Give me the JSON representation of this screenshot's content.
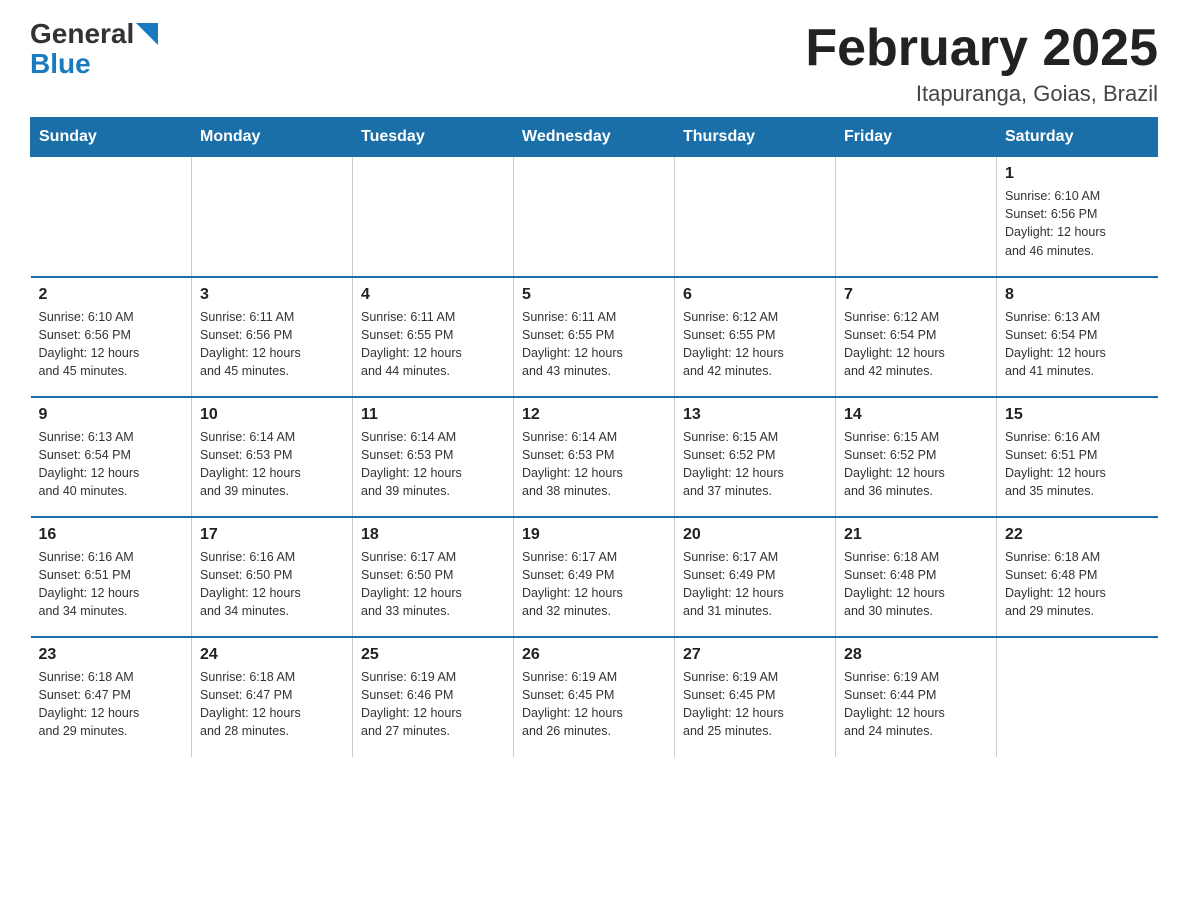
{
  "logo": {
    "general": "General",
    "blue": "Blue",
    "arrow": "▲"
  },
  "title": "February 2025",
  "subtitle": "Itapuranga, Goias, Brazil",
  "days_of_week": [
    "Sunday",
    "Monday",
    "Tuesday",
    "Wednesday",
    "Thursday",
    "Friday",
    "Saturday"
  ],
  "weeks": [
    {
      "days": [
        {
          "num": "",
          "info": ""
        },
        {
          "num": "",
          "info": ""
        },
        {
          "num": "",
          "info": ""
        },
        {
          "num": "",
          "info": ""
        },
        {
          "num": "",
          "info": ""
        },
        {
          "num": "",
          "info": ""
        },
        {
          "num": "1",
          "info": "Sunrise: 6:10 AM\nSunset: 6:56 PM\nDaylight: 12 hours\nand 46 minutes."
        }
      ]
    },
    {
      "days": [
        {
          "num": "2",
          "info": "Sunrise: 6:10 AM\nSunset: 6:56 PM\nDaylight: 12 hours\nand 45 minutes."
        },
        {
          "num": "3",
          "info": "Sunrise: 6:11 AM\nSunset: 6:56 PM\nDaylight: 12 hours\nand 45 minutes."
        },
        {
          "num": "4",
          "info": "Sunrise: 6:11 AM\nSunset: 6:55 PM\nDaylight: 12 hours\nand 44 minutes."
        },
        {
          "num": "5",
          "info": "Sunrise: 6:11 AM\nSunset: 6:55 PM\nDaylight: 12 hours\nand 43 minutes."
        },
        {
          "num": "6",
          "info": "Sunrise: 6:12 AM\nSunset: 6:55 PM\nDaylight: 12 hours\nand 42 minutes."
        },
        {
          "num": "7",
          "info": "Sunrise: 6:12 AM\nSunset: 6:54 PM\nDaylight: 12 hours\nand 42 minutes."
        },
        {
          "num": "8",
          "info": "Sunrise: 6:13 AM\nSunset: 6:54 PM\nDaylight: 12 hours\nand 41 minutes."
        }
      ]
    },
    {
      "days": [
        {
          "num": "9",
          "info": "Sunrise: 6:13 AM\nSunset: 6:54 PM\nDaylight: 12 hours\nand 40 minutes."
        },
        {
          "num": "10",
          "info": "Sunrise: 6:14 AM\nSunset: 6:53 PM\nDaylight: 12 hours\nand 39 minutes."
        },
        {
          "num": "11",
          "info": "Sunrise: 6:14 AM\nSunset: 6:53 PM\nDaylight: 12 hours\nand 39 minutes."
        },
        {
          "num": "12",
          "info": "Sunrise: 6:14 AM\nSunset: 6:53 PM\nDaylight: 12 hours\nand 38 minutes."
        },
        {
          "num": "13",
          "info": "Sunrise: 6:15 AM\nSunset: 6:52 PM\nDaylight: 12 hours\nand 37 minutes."
        },
        {
          "num": "14",
          "info": "Sunrise: 6:15 AM\nSunset: 6:52 PM\nDaylight: 12 hours\nand 36 minutes."
        },
        {
          "num": "15",
          "info": "Sunrise: 6:16 AM\nSunset: 6:51 PM\nDaylight: 12 hours\nand 35 minutes."
        }
      ]
    },
    {
      "days": [
        {
          "num": "16",
          "info": "Sunrise: 6:16 AM\nSunset: 6:51 PM\nDaylight: 12 hours\nand 34 minutes."
        },
        {
          "num": "17",
          "info": "Sunrise: 6:16 AM\nSunset: 6:50 PM\nDaylight: 12 hours\nand 34 minutes."
        },
        {
          "num": "18",
          "info": "Sunrise: 6:17 AM\nSunset: 6:50 PM\nDaylight: 12 hours\nand 33 minutes."
        },
        {
          "num": "19",
          "info": "Sunrise: 6:17 AM\nSunset: 6:49 PM\nDaylight: 12 hours\nand 32 minutes."
        },
        {
          "num": "20",
          "info": "Sunrise: 6:17 AM\nSunset: 6:49 PM\nDaylight: 12 hours\nand 31 minutes."
        },
        {
          "num": "21",
          "info": "Sunrise: 6:18 AM\nSunset: 6:48 PM\nDaylight: 12 hours\nand 30 minutes."
        },
        {
          "num": "22",
          "info": "Sunrise: 6:18 AM\nSunset: 6:48 PM\nDaylight: 12 hours\nand 29 minutes."
        }
      ]
    },
    {
      "days": [
        {
          "num": "23",
          "info": "Sunrise: 6:18 AM\nSunset: 6:47 PM\nDaylight: 12 hours\nand 29 minutes."
        },
        {
          "num": "24",
          "info": "Sunrise: 6:18 AM\nSunset: 6:47 PM\nDaylight: 12 hours\nand 28 minutes."
        },
        {
          "num": "25",
          "info": "Sunrise: 6:19 AM\nSunset: 6:46 PM\nDaylight: 12 hours\nand 27 minutes."
        },
        {
          "num": "26",
          "info": "Sunrise: 6:19 AM\nSunset: 6:45 PM\nDaylight: 12 hours\nand 26 minutes."
        },
        {
          "num": "27",
          "info": "Sunrise: 6:19 AM\nSunset: 6:45 PM\nDaylight: 12 hours\nand 25 minutes."
        },
        {
          "num": "28",
          "info": "Sunrise: 6:19 AM\nSunset: 6:44 PM\nDaylight: 12 hours\nand 24 minutes."
        },
        {
          "num": "",
          "info": ""
        }
      ]
    }
  ]
}
